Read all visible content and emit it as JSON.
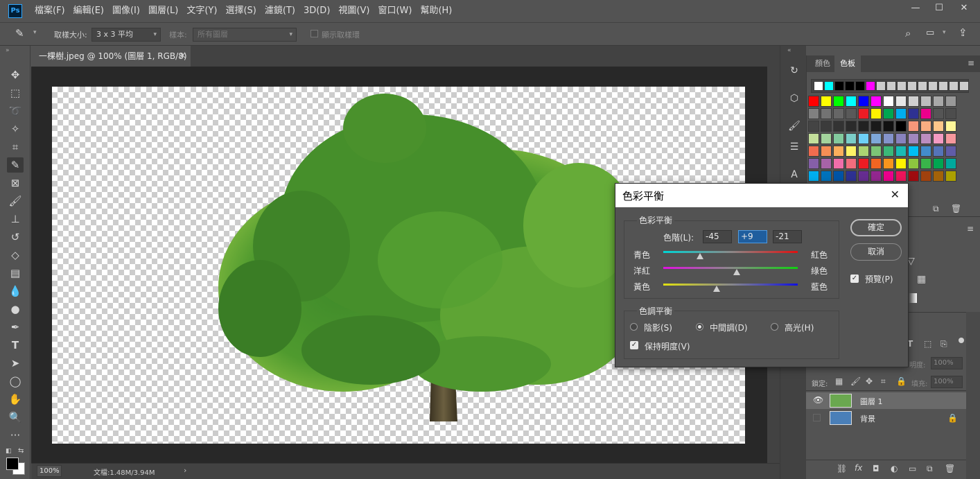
{
  "app": {
    "logo": "Ps"
  },
  "menu": [
    "檔案(F)",
    "編輯(E)",
    "圖像(I)",
    "圖層(L)",
    "文字(Y)",
    "選擇(S)",
    "濾鏡(T)",
    "3D(D)",
    "視圖(V)",
    "窗口(W)",
    "幫助(H)"
  ],
  "options": {
    "sample_size_label": "取樣大小:",
    "sample_size_value": "3 x 3 平均",
    "sample_label": "樣本:",
    "sample_value": "所有圖層",
    "show_ring_label": "顯示取樣環"
  },
  "document": {
    "tab_title": "一棵樹.jpeg @ 100% (圖層 1, RGB/8) *",
    "zoom": "100%",
    "doc_size": "文檔:1.48M/3.94M"
  },
  "panels": {
    "tabs": [
      "顏色",
      "色板"
    ],
    "active_tab": "色板",
    "swatch_rows": [
      [
        "#ffffff",
        "#00ffff",
        "#000000",
        "#000000",
        "#000000",
        "#ff00ff",
        "#cccccc",
        "#cccccc",
        "#cccccc",
        "#cccccc",
        "#cccccc",
        "#cccccc",
        "#cccccc",
        "#cccccc",
        "#cccccc"
      ],
      [
        "#ff0000",
        "#ffff00",
        "#00ff00",
        "#00ffff",
        "#0000ff",
        "#ff00ff",
        "#ffffff",
        "#e6e6e6",
        "#d0d0d0",
        "#bdbdbd",
        "#a8a8a8",
        "#999999"
      ],
      [
        "#808080",
        "#737373",
        "#666666",
        "#595959",
        "#ed1c24",
        "#fff200",
        "#00a651",
        "#00aeef",
        "#2e3192",
        "#ec008c",
        "#555555",
        "#4d4d4d"
      ],
      [
        "#444444",
        "#3b3b3b",
        "#333333",
        "#2b2b2b",
        "#222222",
        "#1a1a1a",
        "#111111",
        "#000000",
        "#f7977a",
        "#f9ad81",
        "#fdc68a",
        "#fff79a"
      ],
      [
        "#c4df9b",
        "#a3d39c",
        "#82ca9d",
        "#7bcdc8",
        "#6ecff6",
        "#7ea7d8",
        "#8493ca",
        "#8882be",
        "#a187be",
        "#bc8dbf",
        "#f49ac2",
        "#f6989d"
      ],
      [
        "#f26c4f",
        "#f68e55",
        "#fbaf5c",
        "#fff467",
        "#acd372",
        "#7cc576",
        "#3bb878",
        "#1abbb4",
        "#00bff3",
        "#438ccb",
        "#5574b9",
        "#605ca8"
      ],
      [
        "#855fa8",
        "#a763a8",
        "#f06eaa",
        "#f26d7d",
        "#ed1c24",
        "#f26522",
        "#f7941d",
        "#fff200",
        "#8dc63f",
        "#39b54a",
        "#00a651",
        "#00a99d"
      ],
      [
        "#00aeef",
        "#0072bc",
        "#0054a6",
        "#2e3192",
        "#662d91",
        "#92278f",
        "#ec008c",
        "#ed145b",
        "#9e0b0f",
        "#a0410d",
        "#a36209",
        "#aba000"
      ]
    ],
    "layers": [
      {
        "name": "圖層 1",
        "visible": true,
        "selected": true
      },
      {
        "name": "背景",
        "visible": false,
        "selected": false,
        "locked": true
      }
    ],
    "opacity_label": "明度:",
    "opacity_value": "100%",
    "lock_label": "鎖定:",
    "fill_label": "填充:",
    "fill_value": "100%"
  },
  "dialog": {
    "title": "色彩平衡",
    "group1_label": "色彩平衡",
    "levels_label": "色階(L):",
    "levels": [
      "-45",
      "+9",
      "-21"
    ],
    "sliders": [
      {
        "left": "青色",
        "right": "紅色",
        "value": -45,
        "colors": [
          "#00d4d4",
          "#e01010"
        ]
      },
      {
        "left": "洋紅",
        "right": "綠色",
        "value": 9,
        "colors": [
          "#e010e0",
          "#10d010"
        ]
      },
      {
        "left": "黃色",
        "right": "藍色",
        "value": -21,
        "colors": [
          "#e0e010",
          "#1010e0"
        ]
      }
    ],
    "group2_label": "色調平衡",
    "tones": [
      "陰影(S)",
      "中間調(D)",
      "高光(H)"
    ],
    "selected_tone": "中間調(D)",
    "preserve_label": "保持明度(V)",
    "preserve_checked": true,
    "ok_label": "確定",
    "cancel_label": "取消",
    "preview_label": "預覽(P)",
    "preview_checked": true
  }
}
